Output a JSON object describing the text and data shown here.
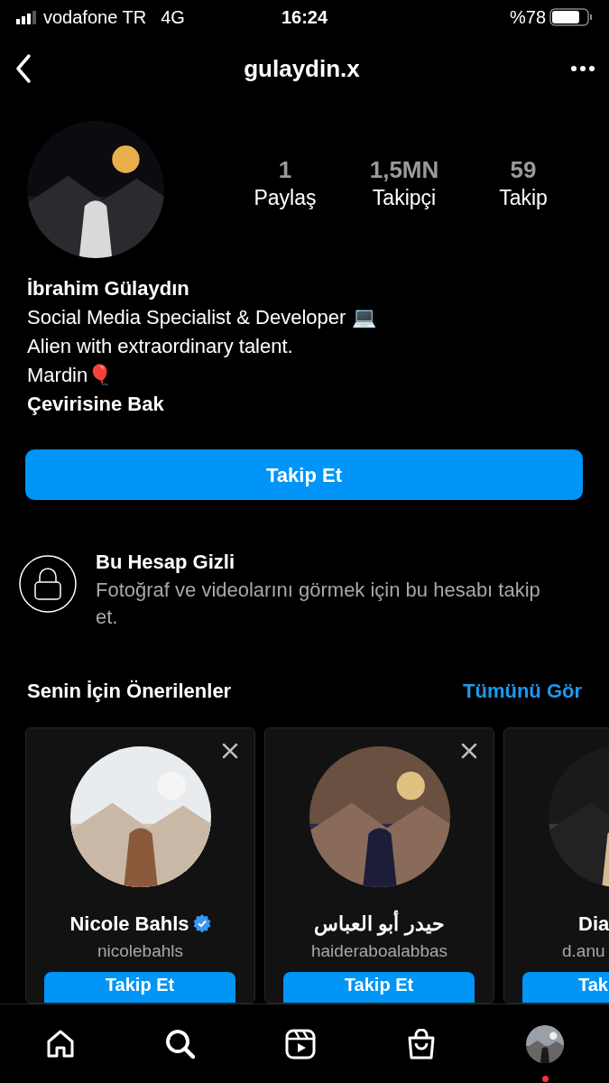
{
  "status_bar": {
    "carrier": "vodafone TR",
    "network": "4G",
    "time": "16:24",
    "battery_text": "%78"
  },
  "header": {
    "username": "gulaydin.x"
  },
  "profile": {
    "stats": [
      {
        "value": "1",
        "label": "Paylaş"
      },
      {
        "value": "1,5MN",
        "label": "Takipçi"
      },
      {
        "value": "59",
        "label": "Takip"
      }
    ],
    "name": "İbrahim Gülaydın",
    "bio": [
      "Social Media Specialist & Developer 💻",
      "Alien with extraordinary talent.",
      "Mardin🎈"
    ],
    "translate_link": "Çevirisine Bak",
    "follow_button": "Takip Et"
  },
  "private_notice": {
    "title": "Bu Hesap Gizli",
    "text": "Fotoğraf ve videolarını görmek için bu hesabı takip et."
  },
  "suggestions": {
    "title": "Senin İçin Önerilenler",
    "see_all": "Tümünü Gör",
    "cards": [
      {
        "name": "Nicole Bahls",
        "username": "nicolebahls",
        "verified": true,
        "button": "Takip Et",
        "dismissible": true
      },
      {
        "name": "حيدر أبو العباس",
        "username": "haideraboalabbas",
        "verified": false,
        "button": "Takip Et",
        "dismissible": true
      },
      {
        "name": "Dia",
        "username": "d.anu",
        "verified": false,
        "button": "Tak",
        "dismissible": false
      }
    ]
  },
  "tab_bar": {
    "items": [
      {
        "kind": "home",
        "selected": false
      },
      {
        "kind": "search",
        "selected": true
      },
      {
        "kind": "reels",
        "selected": false
      },
      {
        "kind": "shop",
        "selected": false
      },
      {
        "kind": "profile",
        "selected": false,
        "notification": true
      }
    ]
  }
}
